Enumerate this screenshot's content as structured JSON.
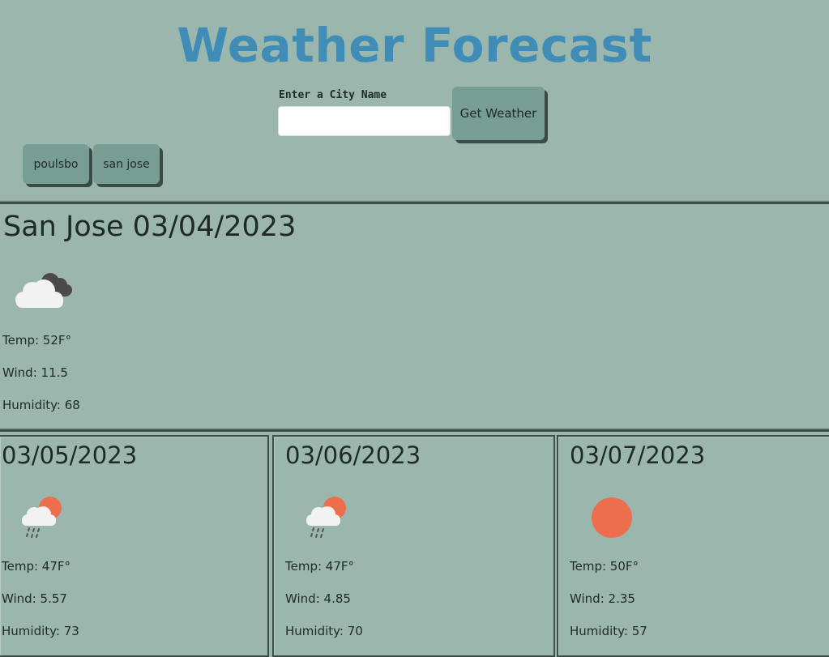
{
  "header": {
    "title": "Weather Forecast",
    "city_label": "Enter a City Name",
    "city_input_value": "",
    "get_weather_label": "Get Weather",
    "accent_color": "#3f8db7"
  },
  "history": [
    {
      "label": "poulsbo"
    },
    {
      "label": "san jose"
    }
  ],
  "today": {
    "title": "San Jose 03/04/2023",
    "icon": "broken-clouds-icon",
    "temp": "Temp: 52F°",
    "wind": "Wind: 11.5",
    "humidity": "Humidity: 68"
  },
  "forecast": [
    {
      "date": "03/05/2023",
      "icon": "rain-sun-icon",
      "temp": "Temp: 47F°",
      "wind": "Wind: 5.57",
      "humidity": "Humidity: 73"
    },
    {
      "date": "03/06/2023",
      "icon": "rain-sun-icon",
      "temp": "Temp: 47F°",
      "wind": "Wind: 4.85",
      "humidity": "Humidity: 70"
    },
    {
      "date": "03/07/2023",
      "icon": "clear-sun-icon",
      "temp": "Temp: 50F°",
      "wind": "Wind: 2.35",
      "humidity": "Humidity: 57"
    }
  ],
  "colors": {
    "background": "#9bb7ad",
    "button": "#789d92",
    "sun": "#ec6e4c"
  }
}
